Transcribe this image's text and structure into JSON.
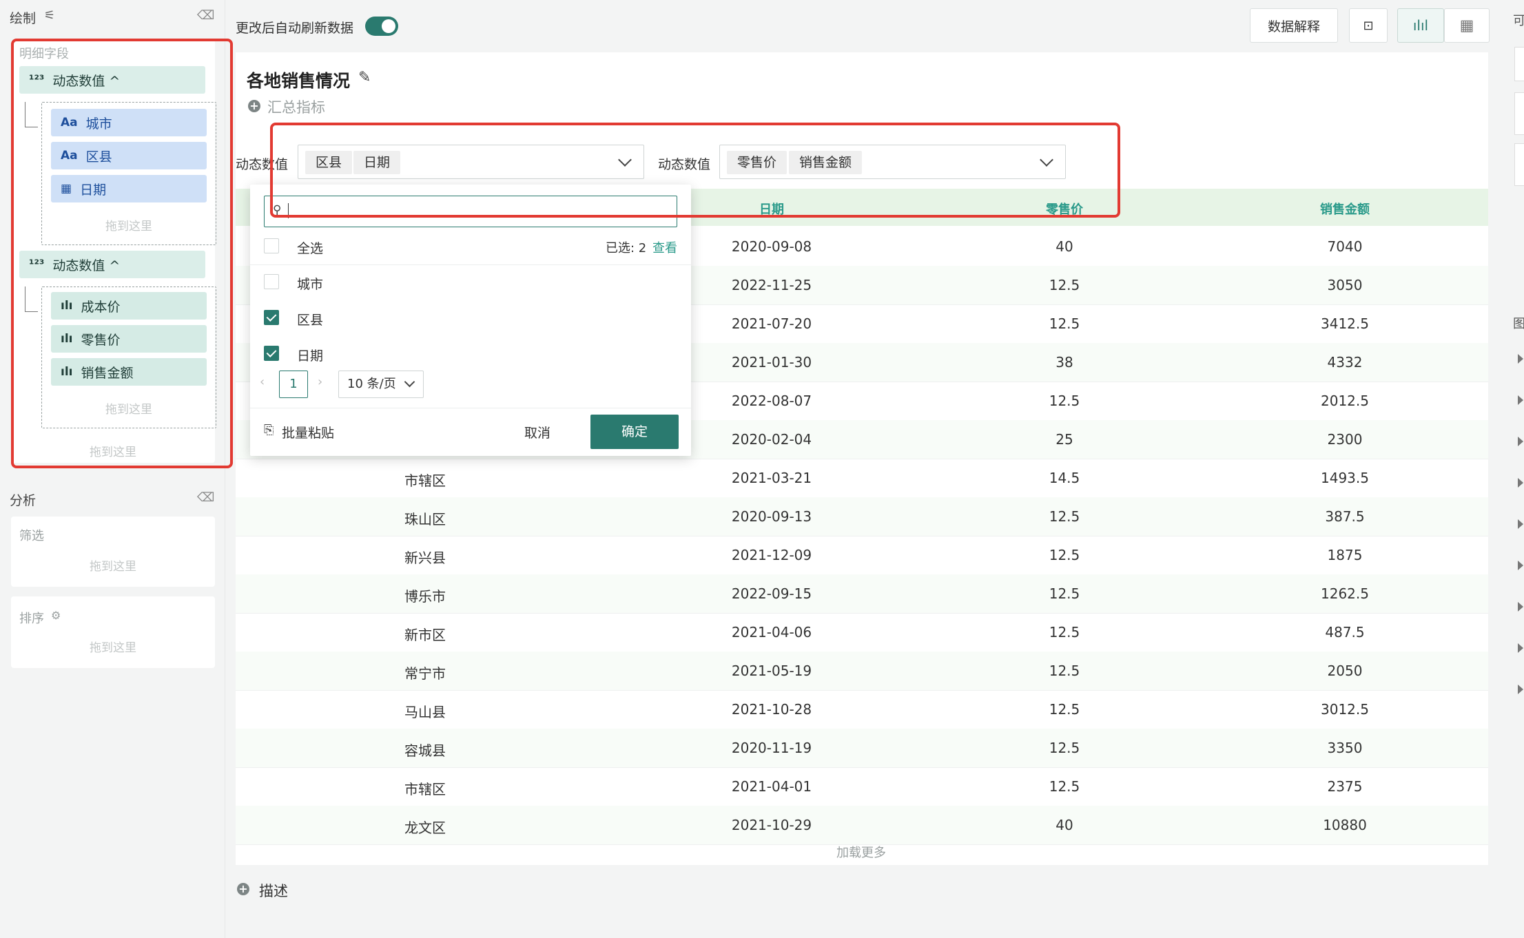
{
  "left": {
    "draw_title": "绘制",
    "detail_fields_label": "明细字段",
    "groups": [
      {
        "label": "动态数值 ^",
        "items": [
          "城市",
          "区县",
          "日期"
        ],
        "drop": "拖到这里"
      },
      {
        "label": "动态数值 ^",
        "items": [
          "成本价",
          "零售价",
          "销售金额"
        ],
        "drop": "拖到这里"
      }
    ],
    "outer_drop": "拖到这里",
    "analysis_title": "分析",
    "filter_label": "筛选",
    "filter_drop": "拖到这里",
    "sort_label": "排序",
    "sort_drop": "拖到这里"
  },
  "top": {
    "auto_refresh_label": "更改后自动刷新数据",
    "auto_refresh_on": true,
    "data_explain_label": "数据解释",
    "right_edge_label": "可",
    "right_edge_label2": "图"
  },
  "main": {
    "title": "各地销售情况",
    "summary_metric": "汇总指标",
    "filter1_label": "动态数值",
    "filter1_tags": [
      "区县",
      "日期"
    ],
    "filter2_label": "动态数值",
    "filter2_tags": [
      "零售价",
      "销售金额"
    ],
    "load_more": "加载更多",
    "describe": "描述"
  },
  "popup": {
    "search_value": "",
    "select_all": "全选",
    "selected_prefix": "已选: 2",
    "view_link": "查看",
    "options": [
      {
        "label": "城市",
        "checked": false
      },
      {
        "label": "区县",
        "checked": true
      },
      {
        "label": "日期",
        "checked": true
      }
    ],
    "page": "1",
    "page_size": "10 条/页",
    "batch_paste": "批量粘贴",
    "cancel": "取消",
    "confirm": "确定"
  },
  "table": {
    "headers": [
      "日期",
      "零售价",
      "销售金额"
    ],
    "rows": [
      [
        "",
        "2020-09-08",
        "40",
        "7040"
      ],
      [
        "",
        "2022-11-25",
        "12.5",
        "3050"
      ],
      [
        "",
        "2021-07-20",
        "12.5",
        "3412.5"
      ],
      [
        "",
        "2021-01-30",
        "38",
        "4332"
      ],
      [
        "",
        "2022-08-07",
        "12.5",
        "2012.5"
      ],
      [
        "",
        "2020-02-04",
        "25",
        "2300"
      ],
      [
        "市辖区",
        "2021-03-21",
        "14.5",
        "1493.5"
      ],
      [
        "珠山区",
        "2020-09-13",
        "12.5",
        "387.5"
      ],
      [
        "新兴县",
        "2021-12-09",
        "12.5",
        "1875"
      ],
      [
        "博乐市",
        "2022-09-15",
        "12.5",
        "1262.5"
      ],
      [
        "新市区",
        "2021-04-06",
        "12.5",
        "487.5"
      ],
      [
        "常宁市",
        "2021-05-19",
        "12.5",
        "2050"
      ],
      [
        "马山县",
        "2021-10-28",
        "12.5",
        "3012.5"
      ],
      [
        "容城县",
        "2020-11-19",
        "12.5",
        "3350"
      ],
      [
        "市辖区",
        "2021-04-01",
        "12.5",
        "2375"
      ],
      [
        "龙文区",
        "2021-10-29",
        "40",
        "10880"
      ]
    ]
  }
}
